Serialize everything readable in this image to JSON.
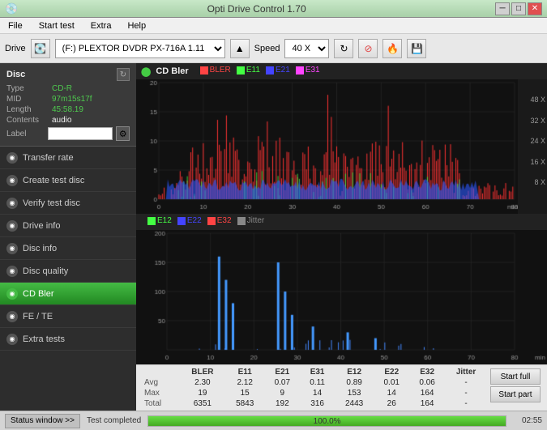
{
  "app": {
    "title": "Opti Drive Control 1.70",
    "icon": "💿"
  },
  "title_bar": {
    "minimize": "─",
    "maximize": "□",
    "close": "✕"
  },
  "menu": {
    "items": [
      "File",
      "Start test",
      "Extra",
      "Help"
    ]
  },
  "toolbar": {
    "drive_label": "Drive",
    "drive_value": "(F:)  PLEXTOR DVDR  PX-716A 1.11",
    "speed_label": "Speed",
    "speed_value": "40 X"
  },
  "disc": {
    "header": "Disc",
    "type_label": "Type",
    "type_value": "CD-R",
    "mid_label": "MID",
    "mid_value": "97m15s17f",
    "length_label": "Length",
    "length_value": "45:58.19",
    "contents_label": "Contents",
    "contents_value": "audio",
    "label_label": "Label",
    "label_value": ""
  },
  "nav_items": [
    {
      "id": "transfer-rate",
      "label": "Transfer rate",
      "active": false
    },
    {
      "id": "create-test-disc",
      "label": "Create test disc",
      "active": false
    },
    {
      "id": "verify-test-disc",
      "label": "Verify test disc",
      "active": false
    },
    {
      "id": "drive-info",
      "label": "Drive info",
      "active": false
    },
    {
      "id": "disc-info",
      "label": "Disc info",
      "active": false
    },
    {
      "id": "disc-quality",
      "label": "Disc quality",
      "active": false
    },
    {
      "id": "cd-bler",
      "label": "CD Bler",
      "active": true
    },
    {
      "id": "fe-te",
      "label": "FE / TE",
      "active": false
    },
    {
      "id": "extra-tests",
      "label": "Extra tests",
      "active": false
    }
  ],
  "chart1": {
    "title": "CD Bler",
    "legend": [
      {
        "label": "BLER",
        "color": "#ff4444"
      },
      {
        "label": "E11",
        "color": "#44ff44"
      },
      {
        "label": "E21",
        "color": "#4444ff"
      },
      {
        "label": "E31",
        "color": "#ff44ff"
      }
    ],
    "x_max": 80,
    "y_max": 20,
    "right_labels": [
      "48 X",
      "32 X",
      "24 X",
      "16 X",
      "8 X"
    ]
  },
  "chart2": {
    "legend": [
      {
        "label": "E12",
        "color": "#44ff44"
      },
      {
        "label": "E22",
        "color": "#4444ff"
      },
      {
        "label": "E32",
        "color": "#ff4444"
      },
      {
        "label": "Jitter",
        "color": "#888888"
      }
    ],
    "x_max": 80,
    "y_max": 200
  },
  "stats": {
    "headers": [
      "",
      "BLER",
      "E11",
      "E21",
      "E31",
      "E12",
      "E22",
      "E32",
      "Jitter"
    ],
    "rows": [
      {
        "label": "Avg",
        "values": [
          "2.30",
          "2.12",
          "0.07",
          "0.11",
          "0.89",
          "0.01",
          "0.06",
          "-"
        ]
      },
      {
        "label": "Max",
        "values": [
          "19",
          "15",
          "9",
          "14",
          "153",
          "14",
          "164",
          "-"
        ]
      },
      {
        "label": "Total",
        "values": [
          "6351",
          "5843",
          "192",
          "316",
          "2443",
          "26",
          "164",
          "-"
        ]
      }
    ],
    "btn_start_full": "Start full",
    "btn_start_part": "Start part"
  },
  "status_bar": {
    "window_btn": "Status window >>",
    "status_text": "Test completed",
    "progress_pct": 100.0,
    "progress_label": "100.0%",
    "time": "02:55"
  }
}
